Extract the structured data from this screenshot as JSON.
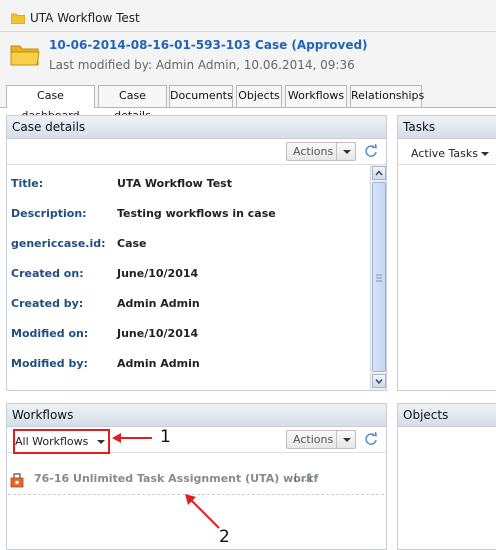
{
  "window": {
    "title": "UTA Workflow Test"
  },
  "case": {
    "title": "10-06-2014-08-16-01-593-103 Case (Approved)",
    "modified": "Last modified by: Admin Admin, 10.06.2014, 09:36"
  },
  "tabs": [
    {
      "label": "Case dashboard",
      "active": true
    },
    {
      "label": "Case details"
    },
    {
      "label": "Documents"
    },
    {
      "label": "Objects"
    },
    {
      "label": "Workflows"
    },
    {
      "label": "Relationships"
    }
  ],
  "case_details": {
    "header": "Case details",
    "actions_label": "Actions",
    "rows": [
      {
        "label": "Title:",
        "value": "UTA Workflow Test"
      },
      {
        "label": "Description:",
        "value": "Testing workflows in case"
      },
      {
        "label": "genericcase.id:",
        "value": "Case"
      },
      {
        "label": "Created on:",
        "value": "June/10/2014"
      },
      {
        "label": "Created by:",
        "value": "Admin Admin"
      },
      {
        "label": "Modified on:",
        "value": "June/10/2014"
      },
      {
        "label": "Modified by:",
        "value": "Admin Admin"
      }
    ]
  },
  "tasks": {
    "header": "Tasks",
    "filter_label": "Active Tasks"
  },
  "workflows": {
    "header": "Workflows",
    "filter_label": "All Workflows",
    "actions_label": "Actions",
    "items": [
      {
        "label": "76-16 Unlimited Task Assignment (UTA) workf",
        "more": "[...]"
      }
    ]
  },
  "objects": {
    "header": "Objects"
  },
  "annotations": {
    "marker1": "1",
    "marker2": "2",
    "color": "#e02020"
  },
  "colors": {
    "link": "#2165b8",
    "label": "#1f4e80",
    "folder": "#f2c230"
  }
}
